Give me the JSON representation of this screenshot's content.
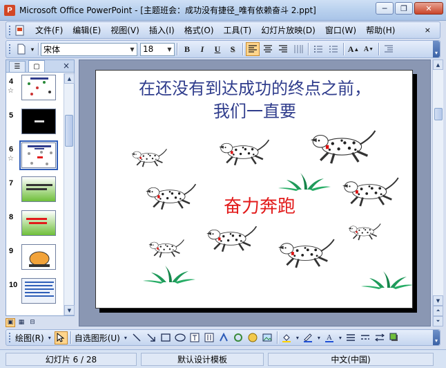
{
  "window": {
    "title": "Microsoft Office PowerPoint - [主题班会：成功没有捷径_唯有依赖奋斗 2.ppt]",
    "minimize": "0",
    "restore": "1",
    "close": "r"
  },
  "menu": {
    "items": [
      "文件(F)",
      "编辑(E)",
      "视图(V)",
      "插入(I)",
      "格式(O)",
      "工具(T)",
      "幻灯片放映(D)",
      "窗口(W)",
      "帮助(H)"
    ],
    "close_doc": "×"
  },
  "toolbar": {
    "font_name": "宋体",
    "font_size": "18",
    "bold": "B",
    "italic": "I",
    "underline": "U",
    "shadow": "S",
    "grow_font": "A",
    "shrink_font": "A"
  },
  "left_pane": {
    "close": "×",
    "slides": [
      {
        "num": "4",
        "star": "☆"
      },
      {
        "num": "5",
        "star": ""
      },
      {
        "num": "6",
        "star": "☆"
      },
      {
        "num": "7",
        "star": ""
      },
      {
        "num": "8",
        "star": ""
      },
      {
        "num": "9",
        "star": ""
      },
      {
        "num": "10",
        "star": ""
      }
    ]
  },
  "slide": {
    "title_line1": "在还没有到达成功的终点之前，",
    "title_line2": "我们一直要",
    "subtitle": "奋力奔跑",
    "title_color": "#2f3c8c",
    "subtitle_color": "#e21a1a"
  },
  "drawbar": {
    "draw_label": "绘图(R)",
    "autoshape_label": "自选图形(U)"
  },
  "status": {
    "slide_info": "幻灯片 6 / 28",
    "template": "默认设计模板",
    "language": "中文(中国)"
  }
}
